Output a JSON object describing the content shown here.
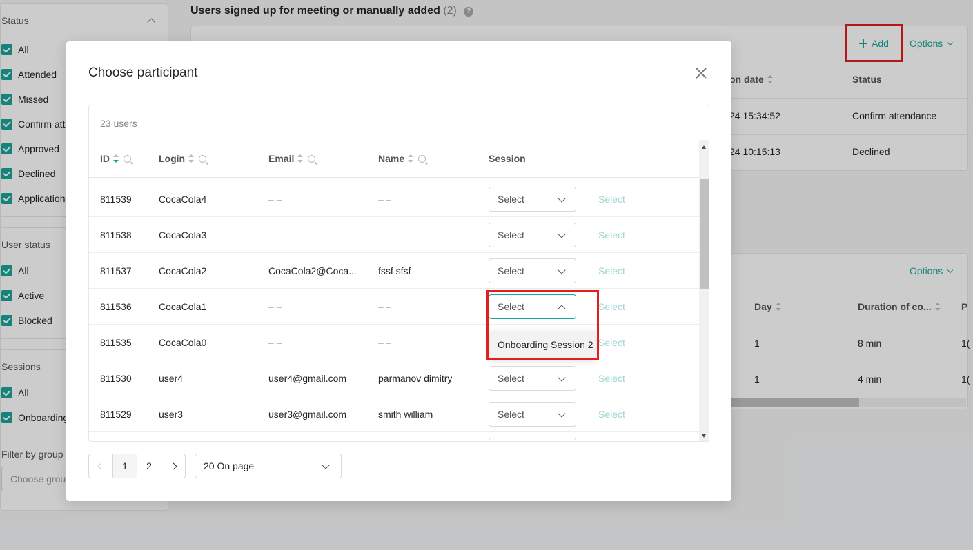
{
  "sidebar": {
    "status": {
      "title": "Status",
      "items": [
        "All",
        "Attended",
        "Missed",
        "Confirm atte",
        "Approved",
        "Declined",
        "Application"
      ]
    },
    "user_status": {
      "title": "User status",
      "items": [
        "All",
        "Active",
        "Blocked"
      ]
    },
    "sessions": {
      "title": "Sessions",
      "items": [
        "All",
        "Onboarding"
      ]
    },
    "group": {
      "title": "Filter by group",
      "placeholder": "Choose group"
    }
  },
  "main": {
    "heading": "Users signed up for meeting or manually added",
    "heading_count": "(2)",
    "help": "?",
    "card1": {
      "add_label": "Add",
      "options_label": "Options",
      "col_date": "on date",
      "col_status": "Status",
      "rows": [
        {
          "date": "24 15:34:52",
          "status": "Confirm attendance"
        },
        {
          "date": "24 10:15:13",
          "status": "Declined"
        }
      ]
    },
    "card2": {
      "options_label": "Options",
      "col_day": "Day",
      "col_duration": "Duration of co...",
      "col_p": "P",
      "rows": [
        {
          "day": "1",
          "duration": "8 min",
          "p": "1("
        },
        {
          "day": "1",
          "duration": "4 min",
          "p": "1("
        }
      ]
    }
  },
  "modal": {
    "title": "Choose participant",
    "users_count": "23 users",
    "columns": {
      "id": "ID",
      "login": "Login",
      "email": "Email",
      "name": "Name",
      "session": "Session"
    },
    "select_placeholder": "Select",
    "select_action": "Select",
    "rows": [
      {
        "id": "811539",
        "login": "CocaCola4",
        "email": "– –",
        "name": "– –"
      },
      {
        "id": "811538",
        "login": "CocaCola3",
        "email": "– –",
        "name": "– –"
      },
      {
        "id": "811537",
        "login": "CocaCola2",
        "email": "CocaCola2@Coca...",
        "name": "fssf sfsf"
      },
      {
        "id": "811536",
        "login": "CocaCola1",
        "email": "– –",
        "name": "– –"
      },
      {
        "id": "811535",
        "login": "CocaCola0",
        "email": "– –",
        "name": "– –"
      },
      {
        "id": "811530",
        "login": "user4",
        "email": "user4@gmail.com",
        "name": "parmanov dimitry"
      },
      {
        "id": "811529",
        "login": "user3",
        "email": "user3@gmail.com",
        "name": "smith william"
      }
    ],
    "dropdown_option": "Onboarding Session 2",
    "pager": {
      "page1": "1",
      "page2": "2"
    },
    "per_page": "20 On page"
  },
  "colors": {
    "accent": "#19a69a",
    "annotation": "#e02020"
  }
}
